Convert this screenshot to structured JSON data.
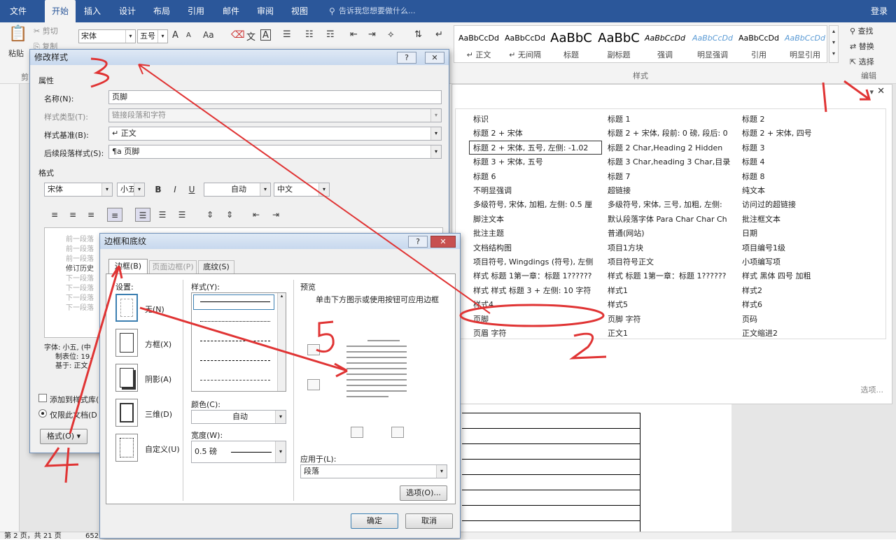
{
  "tabs": [
    "文件",
    "开始",
    "插入",
    "设计",
    "布局",
    "引用",
    "邮件",
    "审阅",
    "视图"
  ],
  "tell_me": "告诉我您想要做什么...",
  "signin": "登录",
  "ribbon": {
    "paste": "粘贴",
    "cut": "剪切",
    "copy": "复制",
    "font_name": "宋体",
    "font_size": "五号",
    "grow": "A",
    "shrink": "A",
    "aa": "Aa",
    "styles": [
      {
        "preview": "AaBbCcDd",
        "name": "↵ 正文"
      },
      {
        "preview": "AaBbCcDd",
        "name": "↵ 无间隔"
      },
      {
        "preview": "AaBbC",
        "name": "标题"
      },
      {
        "preview": "AaBbC",
        "name": "副标题"
      },
      {
        "preview": "AaBbCcDd",
        "name": "强调"
      },
      {
        "preview": "AaBbCcDd",
        "name": "明显强调"
      },
      {
        "preview": "AaBbCcDd",
        "name": "引用"
      },
      {
        "preview": "AaBbCcDd",
        "name": "明显引用"
      }
    ],
    "group_styles": "样式",
    "group_edit": "编辑",
    "find": "查找",
    "replace": "替换",
    "select": "选择",
    "group_clip": "剪"
  },
  "style_pane": {
    "col1": [
      "标识",
      "标题 2 + 宋体",
      "标题 2 + 宋体, 五号, 左侧:  -1.02",
      "标题 3 + 宋体, 五号",
      "标题 6",
      "不明显强调",
      "多级符号, 宋体, 加粗, 左侧:  0.5 厘",
      "脚注文本",
      "批注主题",
      "文档结构图",
      "项目符号, Wingdings (符号), 左侧",
      "样式 标题 1第一章：标题 1??????",
      "样式 样式 标题 3 + 左侧:  10 字符",
      "样式4",
      "页脚",
      "页眉 字符"
    ],
    "col2": [
      "标题 1",
      "标题 2 + 宋体, 段前: 0 磅, 段后: 0",
      "标题 2 Char,Heading 2 Hidden",
      "标题 3 Char,heading 3 Char,目录",
      "标题 7",
      "超链接",
      "多级符号, 宋体, 三号, 加粗, 左侧:",
      "默认段落字体 Para Char Char Ch",
      "普通(网站)",
      "项目1方块",
      "项目符号正文",
      "样式 标题 1第一章：标题 1??????",
      "样式1",
      "样式5",
      "页脚 字符",
      "正文1"
    ],
    "col3": [
      "标题 2",
      "标题 2 + 宋体, 四号",
      "标题 3",
      "标题 4",
      "标题 8",
      "纯文本",
      "访问过的超链接",
      "批注框文本",
      "日期",
      "项目编号1级",
      "小项编写项",
      "样式 黑体 四号 加粗",
      "样式2",
      "样式6",
      "页码",
      "正文缩进2"
    ],
    "options": "选项..."
  },
  "modify_dialog": {
    "title": "修改样式",
    "help": "?",
    "close": "✕",
    "section_props": "属性",
    "name_label": "名称(N):",
    "name_value": "页脚",
    "type_label": "样式类型(T):",
    "type_value": "链接段落和字符",
    "based_label": "样式基准(B):",
    "based_value": "↵ 正文",
    "next_label": "后续段落样式(S):",
    "next_value": "¶a 页脚",
    "section_format": "格式",
    "font": "宋体",
    "size": "小五",
    "bold": "B",
    "italic": "I",
    "underline": "U",
    "color": "自动",
    "lang": "中文",
    "preview_lines": [
      "前一段落",
      "前一段落",
      "前一段落",
      "修订历史",
      "下一段落",
      "下一段落",
      "下一段落",
      "下一段落"
    ],
    "desc": [
      "字体: 小五, (中",
      "制表位: 19.",
      "基于: 正文"
    ],
    "add_gallery": "添加到样式库(",
    "only_doc": "仅限此文档(D",
    "format_btn": "格式(O) ▾"
  },
  "border_dialog": {
    "title": "边框和底纹",
    "help": "?",
    "close": "✕",
    "tabs": [
      "边框(B)",
      "页面边框(P)",
      "底纹(S)"
    ],
    "setting_label": "设置:",
    "settings": [
      "无(N)",
      "方框(X)",
      "阴影(A)",
      "三维(D)",
      "自定义(U)"
    ],
    "style_label": "样式(Y):",
    "color_label": "颜色(C):",
    "color_value": "自动",
    "width_label": "宽度(W):",
    "width_value": "0.5 磅",
    "preview_label": "预览",
    "preview_hint": "单击下方图示或使用按钮可应用边框",
    "apply_label": "应用于(L):",
    "apply_value": "段落",
    "options_btn": "选项(O)...",
    "ok": "确定",
    "cancel": "取消"
  },
  "status": {
    "page": "第 2 页，共 21 页",
    "words": "652"
  },
  "annotations": [
    "1",
    "2",
    "3",
    "4",
    "5"
  ],
  "colors": {
    "accent": "#2b579a",
    "annotation": "#e03434"
  }
}
